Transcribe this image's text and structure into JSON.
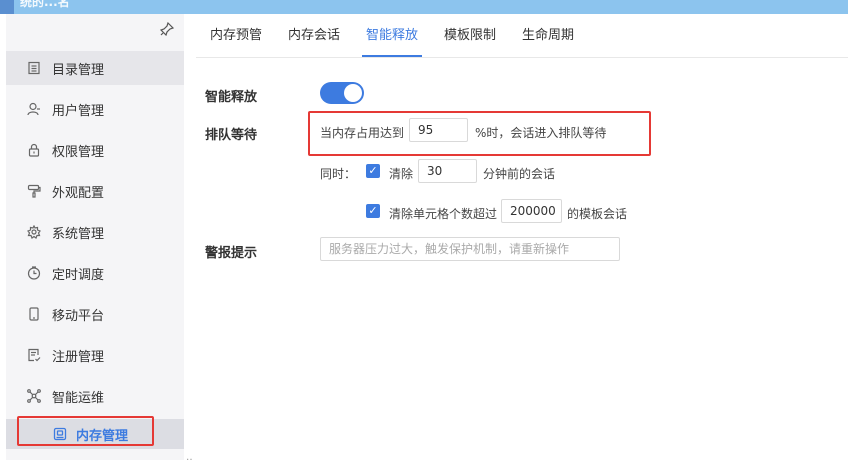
{
  "topbar": {
    "title_fragment": "统的...名"
  },
  "sidebar": {
    "pin_icon": "pin-icon",
    "items": [
      {
        "label": "目录管理",
        "icon": "catalog-icon"
      },
      {
        "label": "用户管理",
        "icon": "user-icon"
      },
      {
        "label": "权限管理",
        "icon": "lock-icon"
      },
      {
        "label": "外观配置",
        "icon": "paint-roller-icon"
      },
      {
        "label": "系统管理",
        "icon": "gear-icon"
      },
      {
        "label": "定时调度",
        "icon": "clock-icon"
      },
      {
        "label": "移动平台",
        "icon": "mobile-icon"
      },
      {
        "label": "注册管理",
        "icon": "register-icon"
      },
      {
        "label": "智能运维",
        "icon": "network-icon"
      }
    ],
    "sub_item": {
      "label": "内存管理",
      "icon": "memory-icon"
    }
  },
  "tabs": [
    {
      "label": "内存预管"
    },
    {
      "label": "内存会话"
    },
    {
      "label": "智能释放",
      "active": true
    },
    {
      "label": "模板限制"
    },
    {
      "label": "生命周期"
    }
  ],
  "form": {
    "smart_release_label": "智能释放",
    "smart_release_enabled": true,
    "queue_label": "排队等待",
    "queue_prefix": "当内存占用达到",
    "queue_threshold": "95",
    "queue_suffix": "%时，会话进入排队等待",
    "simultaneous_label": "同时：",
    "clear_label": "清除",
    "clear_minutes": "30",
    "clear_minutes_suffix": "分钟前的会话",
    "clear_cells_label": "清除单元格个数超过",
    "clear_cells_value": "200000",
    "clear_cells_suffix": "的模板会话",
    "alert_label": "警报提示",
    "alert_placeholder": "服务器压力过大，触发保护机制，请重新操作"
  },
  "colors": {
    "accent": "#3d7be0",
    "highlight": "#e53935",
    "topbar": "#8cc4ee"
  }
}
